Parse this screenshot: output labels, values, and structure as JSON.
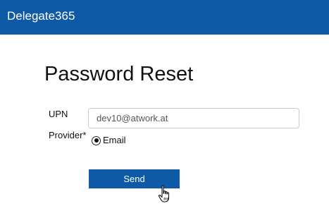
{
  "header": {
    "brand": "Delegate365",
    "background": "#0f5aa6"
  },
  "page": {
    "title": "Password Reset"
  },
  "form": {
    "upn_label": "UPN",
    "upn_value": "dev10@atwork.at",
    "provider_label": "Provider*",
    "provider_options": [
      {
        "label": "Email",
        "selected": true
      }
    ],
    "send_label": "Send"
  },
  "icons": {
    "cursor": "hand-pointer-icon"
  }
}
